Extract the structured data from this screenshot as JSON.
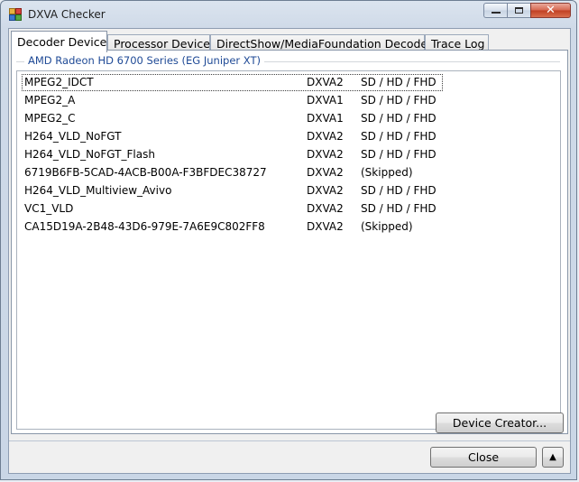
{
  "window": {
    "title": "DXVA Checker"
  },
  "tabs": [
    {
      "label": "Decoder Device"
    },
    {
      "label": "Processor Device"
    },
    {
      "label": "DirectShow/MediaFoundation Decoder"
    },
    {
      "label": "Trace Log"
    }
  ],
  "group": {
    "label": "AMD Radeon HD 6700 Series (EG Juniper XT)"
  },
  "decoders": [
    {
      "name": "MPEG2_IDCT",
      "api": "DXVA2",
      "res": "SD / HD / FHD"
    },
    {
      "name": "MPEG2_A",
      "api": "DXVA1",
      "res": "SD / HD / FHD"
    },
    {
      "name": "MPEG2_C",
      "api": "DXVA1",
      "res": "SD / HD / FHD"
    },
    {
      "name": "H264_VLD_NoFGT",
      "api": "DXVA2",
      "res": "SD / HD / FHD"
    },
    {
      "name": "H264_VLD_NoFGT_Flash",
      "api": "DXVA2",
      "res": "SD / HD / FHD"
    },
    {
      "name": "6719B6FB-5CAD-4ACB-B00A-F3BFDEC38727",
      "api": "DXVA2",
      "res": "(Skipped)"
    },
    {
      "name": "H264_VLD_Multiview_Avivo",
      "api": "DXVA2",
      "res": "SD / HD / FHD"
    },
    {
      "name": "VC1_VLD",
      "api": "DXVA2",
      "res": "SD / HD / FHD"
    },
    {
      "name": "CA15D19A-2B48-43D6-979E-7A6E9C802FF8",
      "api": "DXVA2",
      "res": "(Skipped)"
    }
  ],
  "buttons": {
    "device_creator": "Device Creator...",
    "close": "Close",
    "expand": "▲"
  }
}
